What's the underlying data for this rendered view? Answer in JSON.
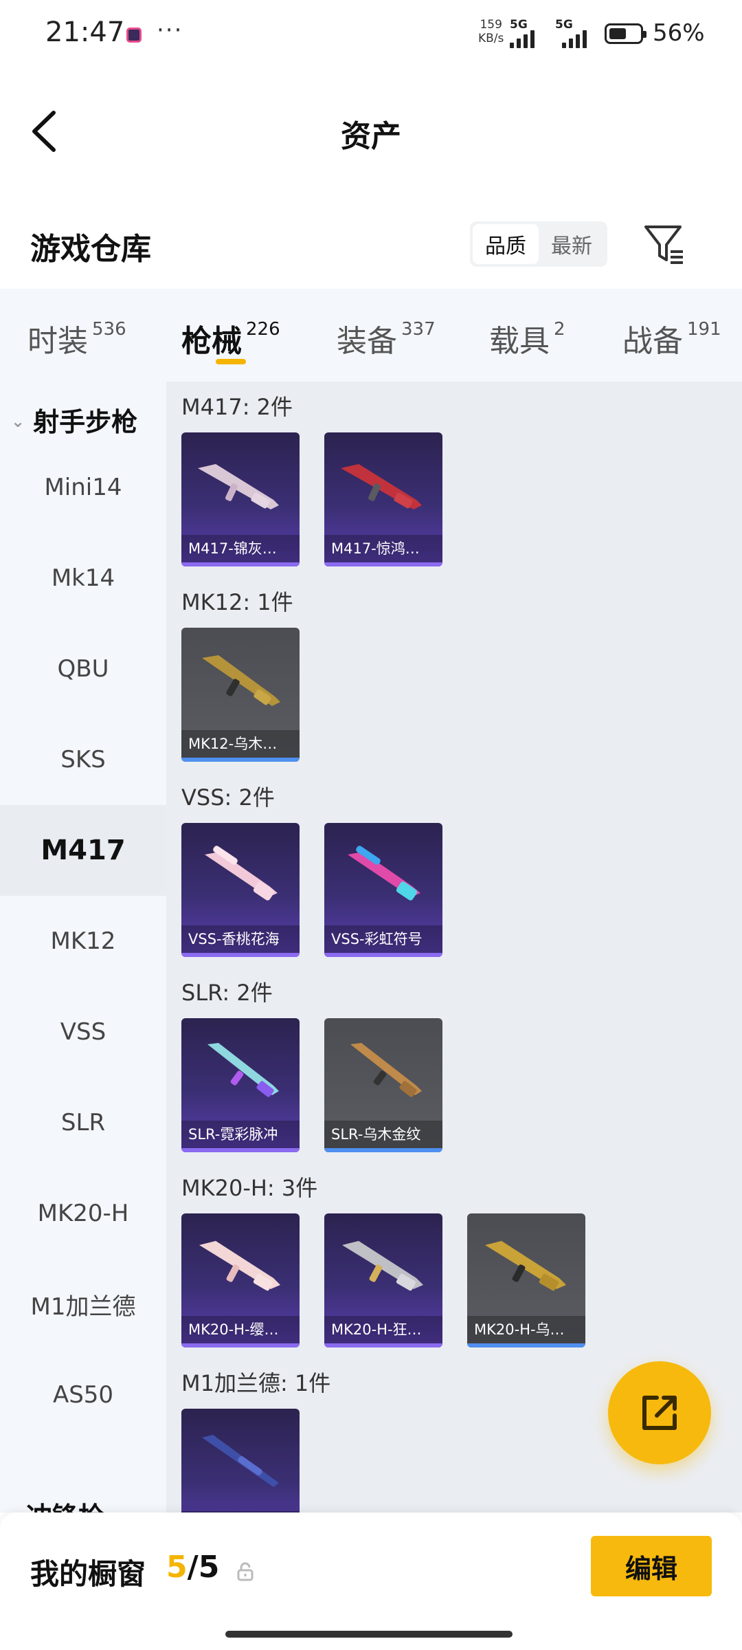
{
  "status_bar": {
    "time": "21:47",
    "dots": "···",
    "speed_value": "159",
    "speed_unit": "KB/s",
    "net1": "5G",
    "net2": "5G",
    "battery": "56%"
  },
  "header": {
    "title": "资产",
    "back_icon": "chevron-left-icon"
  },
  "warehouse": {
    "title": "游戏仓库",
    "sort_options": [
      "品质",
      "最新"
    ],
    "sort_selected": "品质",
    "filter_icon": "filter-icon"
  },
  "tabs": [
    {
      "label": "时装",
      "count": "536"
    },
    {
      "label": "枪械",
      "count": "226"
    },
    {
      "label": "装备",
      "count": "337"
    },
    {
      "label": "载具",
      "count": "2"
    },
    {
      "label": "战备",
      "count": "191"
    }
  ],
  "active_tab": "枪械",
  "sidebar": {
    "group": "射手步枪",
    "items": [
      "Mini14",
      "Mk14",
      "QBU",
      "SKS",
      "M417",
      "MK12",
      "VSS",
      "SLR",
      "MK20-H",
      "M1加兰德",
      "AS50"
    ],
    "active": "M417",
    "next_group": "冲锋枪"
  },
  "groups": [
    {
      "title": "M417: 2件",
      "items": [
        {
          "name": "M417-锦灰…",
          "rarity": "purple"
        },
        {
          "name": "M417-惊鸿…",
          "rarity": "purple"
        }
      ]
    },
    {
      "title": "MK12: 1件",
      "items": [
        {
          "name": "MK12-乌木…",
          "rarity": "grey"
        }
      ]
    },
    {
      "title": "VSS: 2件",
      "items": [
        {
          "name": "VSS-香桃花海",
          "rarity": "purple"
        },
        {
          "name": "VSS-彩虹符号",
          "rarity": "purple"
        }
      ]
    },
    {
      "title": "SLR: 2件",
      "items": [
        {
          "name": "SLR-霓彩脉冲",
          "rarity": "purple"
        },
        {
          "name": "SLR-乌木金纹",
          "rarity": "grey"
        }
      ]
    },
    {
      "title": "MK20-H: 3件",
      "items": [
        {
          "name": "MK20-H-缨…",
          "rarity": "purple"
        },
        {
          "name": "MK20-H-狂…",
          "rarity": "purple"
        },
        {
          "name": "MK20-H-乌…",
          "rarity": "grey"
        }
      ]
    },
    {
      "title": "M1加兰德: 1件",
      "items": [
        {
          "name": "",
          "rarity": "purple"
        }
      ]
    }
  ],
  "colors": {
    "accent": "#f7b90d",
    "tab_underline": "#f4b400",
    "purple_bar": "#8a6bf0",
    "blue_bar": "#4f8ff0"
  },
  "bottom": {
    "showcase_label": "我的橱窗",
    "showcase_current": "5",
    "showcase_separator": "/",
    "showcase_total": "5",
    "edit_label": "编辑",
    "fab_icon": "share-icon"
  }
}
